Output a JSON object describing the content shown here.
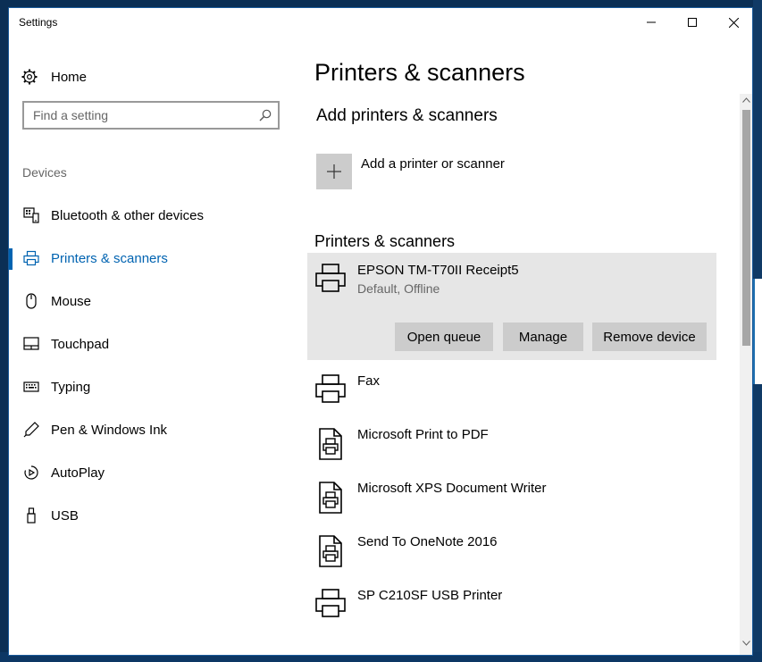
{
  "window": {
    "title": "Settings"
  },
  "sidebar": {
    "home_label": "Home",
    "search_placeholder": "Find a setting",
    "section_label": "Devices",
    "items": [
      {
        "label": "Bluetooth & other devices",
        "icon": "bluetooth-devices-icon"
      },
      {
        "label": "Printers & scanners",
        "icon": "printer-icon",
        "active": true
      },
      {
        "label": "Mouse",
        "icon": "mouse-icon"
      },
      {
        "label": "Touchpad",
        "icon": "touchpad-icon"
      },
      {
        "label": "Typing",
        "icon": "keyboard-icon"
      },
      {
        "label": "Pen & Windows Ink",
        "icon": "pen-icon"
      },
      {
        "label": "AutoPlay",
        "icon": "autoplay-icon"
      },
      {
        "label": "USB",
        "icon": "usb-icon"
      }
    ]
  },
  "main": {
    "page_title": "Printers & scanners",
    "add_section_title": "Add printers & scanners",
    "add_label": "Add a printer or scanner",
    "list_title": "Printers & scanners",
    "devices": [
      {
        "name": "EPSON TM-T70II Receipt5",
        "status": "Default, Offline",
        "icon": "printer-icon",
        "buttons": {
          "open_queue": "Open queue",
          "manage": "Manage",
          "remove": "Remove device"
        }
      },
      {
        "name": "Fax",
        "icon": "printer-icon"
      },
      {
        "name": "Microsoft Print to PDF",
        "icon": "document-printer-icon"
      },
      {
        "name": "Microsoft XPS Document Writer",
        "icon": "document-printer-icon"
      },
      {
        "name": "Send To OneNote 2016",
        "icon": "document-printer-icon"
      },
      {
        "name": "SP C210SF USB Printer",
        "icon": "printer-icon"
      }
    ]
  },
  "colors": {
    "accent": "#0063b1",
    "tile": "#cccccc",
    "selected_bg": "#e6e6e6"
  }
}
